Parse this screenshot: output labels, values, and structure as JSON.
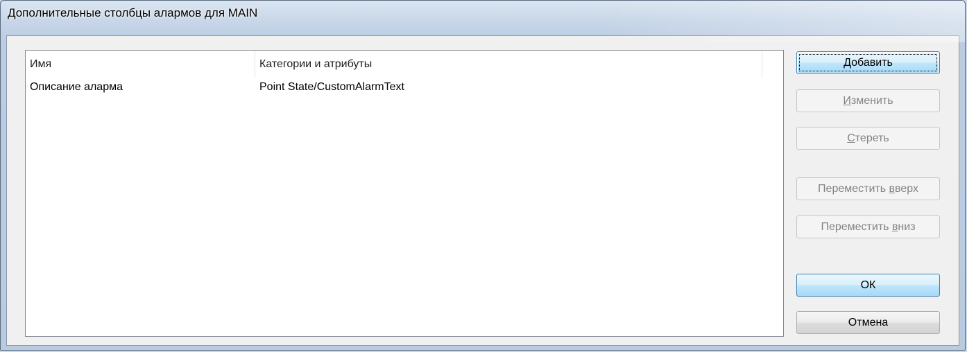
{
  "window": {
    "title": "Дополнительные столбцы алармов для MAIN"
  },
  "list": {
    "columns": [
      "Имя",
      "Категории и атрибуты"
    ],
    "rows": [
      {
        "name": "Описание аларма",
        "category": "Point State/CustomAlarmText"
      }
    ]
  },
  "buttons": {
    "add": {
      "first": "Д",
      "rest": "обавить"
    },
    "edit": {
      "first": "И",
      "rest": "зменить"
    },
    "delete": {
      "first": "С",
      "rest": "тереть"
    },
    "move_up": {
      "prefix": "Переместить ",
      "mnemonic": "в",
      "suffix": "верх"
    },
    "move_down": {
      "prefix": "Переместить ",
      "mnemonic": "в",
      "suffix": "низ"
    },
    "ok": "ОК",
    "cancel": "Отмена"
  },
  "colors": {
    "title_gradient_top": "#dbe5f1",
    "title_gradient_bottom": "#b9cbe0",
    "client_bg": "#f0f0f0",
    "list_bg": "#ffffff",
    "disabled_text": "#838383",
    "focus_border": "#3c7fb1"
  }
}
